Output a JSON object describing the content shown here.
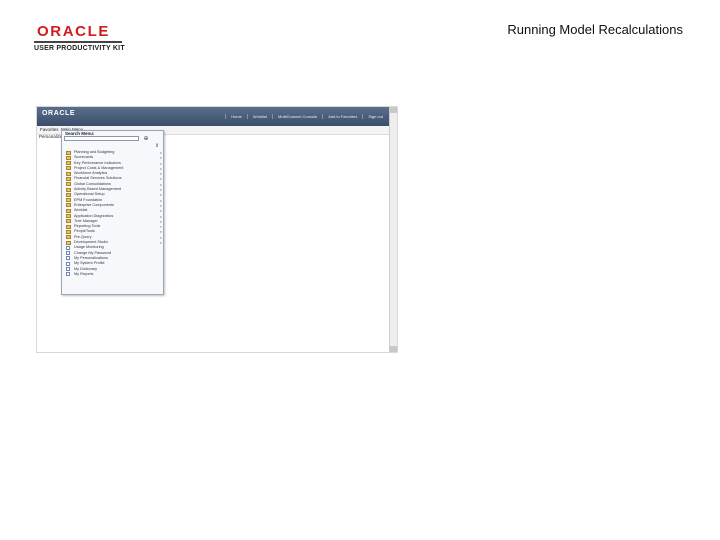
{
  "branding": {
    "logo_text": "ORACLE",
    "subtitle": "USER PRODUCTIVITY KIT"
  },
  "slide_title": "Running Model Recalculations",
  "app": {
    "logo_text": "ORACLE",
    "header_links": [
      "Home",
      "Worklist",
      "MultiChannel Console",
      "Add to Favorites",
      "Sign out"
    ],
    "nav_crumb": "Favorites",
    "nav_menu": "Main Menu",
    "personalize": "Personalize",
    "menu": {
      "title": "Search Menu:",
      "search_value": "",
      "items": [
        {
          "label": "Planning and Budgeting",
          "type": "folder"
        },
        {
          "label": "Scorecards",
          "type": "folder"
        },
        {
          "label": "Key Performance Indicators",
          "type": "folder"
        },
        {
          "label": "Project Costs & Management",
          "type": "folder"
        },
        {
          "label": "Workforce Analytics",
          "type": "folder"
        },
        {
          "label": "Financial Services Solutions",
          "type": "folder"
        },
        {
          "label": "Global Consolidations",
          "type": "folder"
        },
        {
          "label": "Activity Based Management",
          "type": "folder"
        },
        {
          "label": "Operational Setup",
          "type": "folder"
        },
        {
          "label": "EPM Foundation",
          "type": "folder"
        },
        {
          "label": "Enterprise Components",
          "type": "folder"
        },
        {
          "label": "Worklist",
          "type": "folder"
        },
        {
          "label": "Application Diagnostics",
          "type": "folder"
        },
        {
          "label": "Tree Manager",
          "type": "folder"
        },
        {
          "label": "Reporting Tools",
          "type": "folder"
        },
        {
          "label": "PeopleTools",
          "type": "folder"
        },
        {
          "label": "Pre-Query",
          "type": "folder"
        },
        {
          "label": "Development Studio",
          "type": "folder"
        },
        {
          "label": "Usage Monitoring",
          "type": "page"
        },
        {
          "label": "Change My Password",
          "type": "page"
        },
        {
          "label": "My Personalizations",
          "type": "page"
        },
        {
          "label": "My System Profile",
          "type": "page"
        },
        {
          "label": "My Dictionary",
          "type": "page"
        },
        {
          "label": "My Reports",
          "type": "page"
        }
      ]
    }
  }
}
